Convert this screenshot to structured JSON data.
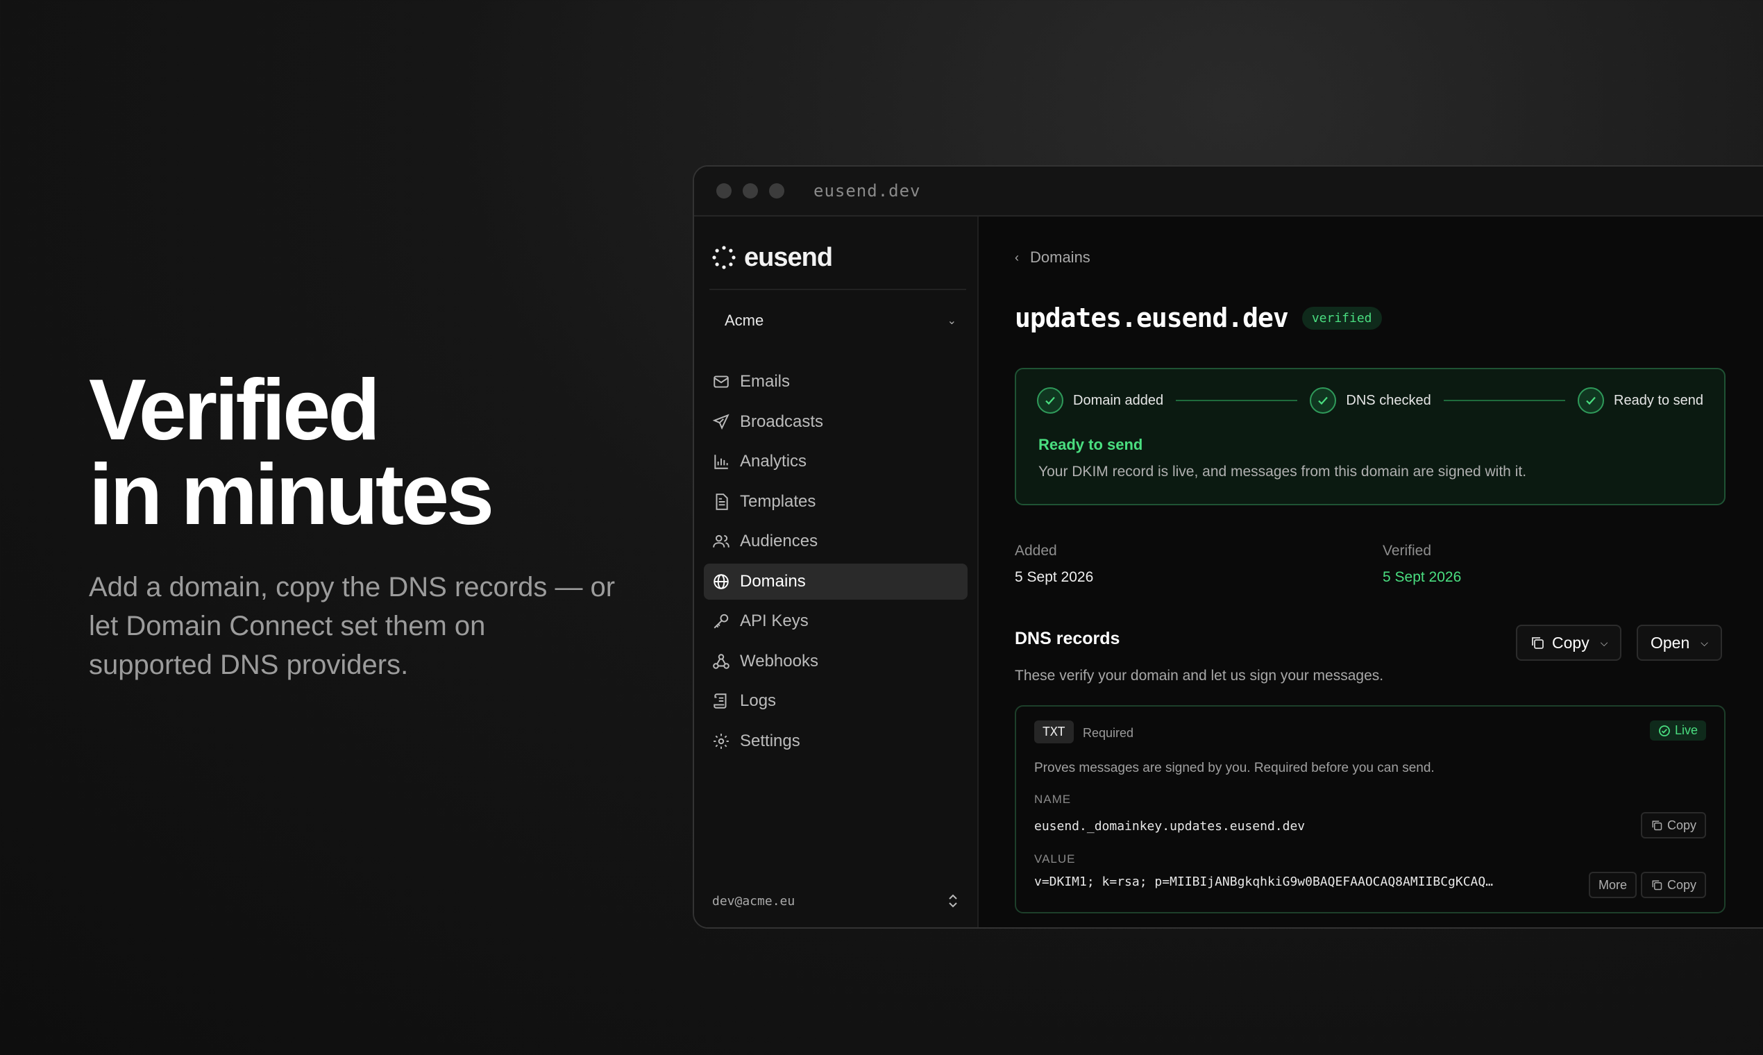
{
  "hero": {
    "title_line1": "Verified",
    "title_line2": "in minutes",
    "subtitle": "Add a domain, copy the DNS records — or let Domain Connect set them on supported DNS providers."
  },
  "window": {
    "url": "eusend.dev"
  },
  "sidebar": {
    "brand": "eusend",
    "team": "Acme",
    "items": [
      {
        "label": "Emails",
        "icon": "mail-icon"
      },
      {
        "label": "Broadcasts",
        "icon": "send-icon"
      },
      {
        "label": "Analytics",
        "icon": "bar-chart-icon"
      },
      {
        "label": "Templates",
        "icon": "file-icon"
      },
      {
        "label": "Audiences",
        "icon": "users-icon"
      },
      {
        "label": "Domains",
        "icon": "globe-icon"
      },
      {
        "label": "API Keys",
        "icon": "key-icon"
      },
      {
        "label": "Webhooks",
        "icon": "webhook-icon"
      },
      {
        "label": "Logs",
        "icon": "scroll-icon"
      },
      {
        "label": "Settings",
        "icon": "gear-icon"
      }
    ],
    "active": "Domains",
    "user_email": "dev@acme.eu"
  },
  "main": {
    "breadcrumb": "Domains",
    "domain": "updates.eusend.dev",
    "domain_badge": "verified",
    "steps": [
      "Domain added",
      "DNS checked",
      "Ready to send"
    ],
    "status_title": "Ready to send",
    "status_desc": "Your DKIM record is live, and messages from this domain are signed with it.",
    "added_label": "Added",
    "added_value": "5 Sept 2026",
    "verified_label": "Verified",
    "verified_value": "5 Sept 2026",
    "dns_title": "DNS records",
    "dns_sub": "These verify your domain and let us sign your messages.",
    "copy_btn": "Copy",
    "open_btn": "Open",
    "record": {
      "type": "TXT",
      "required": "Required",
      "status": "Live",
      "desc": "Proves messages are signed by you. Required before you can send.",
      "name_label": "NAME",
      "name_value": "eusend._domainkey.updates.eusend.dev",
      "value_label": "VALUE",
      "value_value": "v=DKIM1; k=rsa; p=MIIBIjANBgkqhkiG9w0BAQEFAAOCAQ8AMIIBCgKCAQ…",
      "copy_label": "Copy",
      "more_label": "More"
    }
  },
  "colors": {
    "accent_green": "#4ade80",
    "background": "#0e0e0e"
  }
}
